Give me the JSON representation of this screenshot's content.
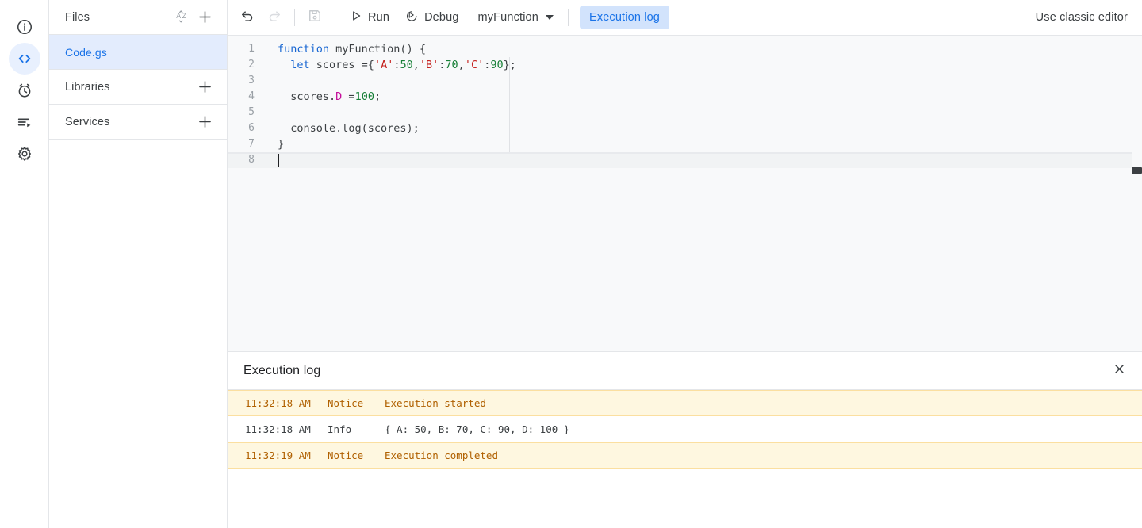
{
  "rail": {
    "items": [
      {
        "name": "overview-icon",
        "label": "Overview",
        "active": false
      },
      {
        "name": "editor-icon",
        "label": "Editor",
        "active": true
      },
      {
        "name": "triggers-icon",
        "label": "Triggers",
        "active": false
      },
      {
        "name": "executions-icon",
        "label": "Executions",
        "active": false
      },
      {
        "name": "settings-icon",
        "label": "Project Settings",
        "active": false
      }
    ]
  },
  "sidebar": {
    "files_title": "Files",
    "sort_icon": "sort-az-icon",
    "add_file_icon": "plus-icon",
    "file": {
      "name": "Code.gs"
    },
    "libraries_title": "Libraries",
    "services_title": "Services"
  },
  "toolbar": {
    "undo_label": "Undo",
    "redo_label": "Redo",
    "save_label": "Save project",
    "run_label": "Run",
    "debug_label": "Debug",
    "function_name": "myFunction",
    "execution_log_tab": "Execution log",
    "classic_editor": "Use classic editor"
  },
  "editor": {
    "lines": [
      {
        "n": "1",
        "active": false
      },
      {
        "n": "2",
        "active": false
      },
      {
        "n": "3",
        "active": false
      },
      {
        "n": "4",
        "active": false
      },
      {
        "n": "5",
        "active": false
      },
      {
        "n": "6",
        "active": false
      },
      {
        "n": "7",
        "active": false
      },
      {
        "n": "8",
        "active": true
      }
    ],
    "code": {
      "l1_kw": "function",
      "l1_rest": " myFunction() {",
      "l2_indent": "  ",
      "l2_kw": "let",
      "l2_a": " scores ={",
      "l2_sA": "'A'",
      "l2_c1": ":",
      "l2_n1": "50",
      "l2_c2": ",",
      "l2_sB": "'B'",
      "l2_c3": ":",
      "l2_n2": "70",
      "l2_c4": ",",
      "l2_sC": "'C'",
      "l2_c5": ":",
      "l2_n3": "90",
      "l2_end": "};",
      "l4_a": "  scores.",
      "l4_prop": "D",
      "l4_b": " =",
      "l4_num": "100",
      "l4_c": ";",
      "l6": "  console.log(scores);",
      "l7": "}"
    }
  },
  "log": {
    "title": "Execution log",
    "close_icon": "close-icon",
    "columns": [
      "time",
      "severity",
      "message"
    ],
    "rows": [
      {
        "time": "11:32:18 AM",
        "severity": "Notice",
        "message": "Execution started",
        "level": "notice"
      },
      {
        "time": "11:32:18 AM",
        "severity": "Info",
        "message": "{ A: 50, B: 70, C: 90, D: 100 }",
        "level": "info"
      },
      {
        "time": "11:32:19 AM",
        "severity": "Notice",
        "message": "Execution completed",
        "level": "notice"
      }
    ]
  },
  "colors": {
    "accent_blue": "#1a73e8",
    "active_tab_bg": "#d2e3fc",
    "file_selected_bg": "#e3ecfd",
    "notice_bg": "#fef7e0",
    "notice_text": "#b06000",
    "editor_bg": "#f8f9fa"
  }
}
